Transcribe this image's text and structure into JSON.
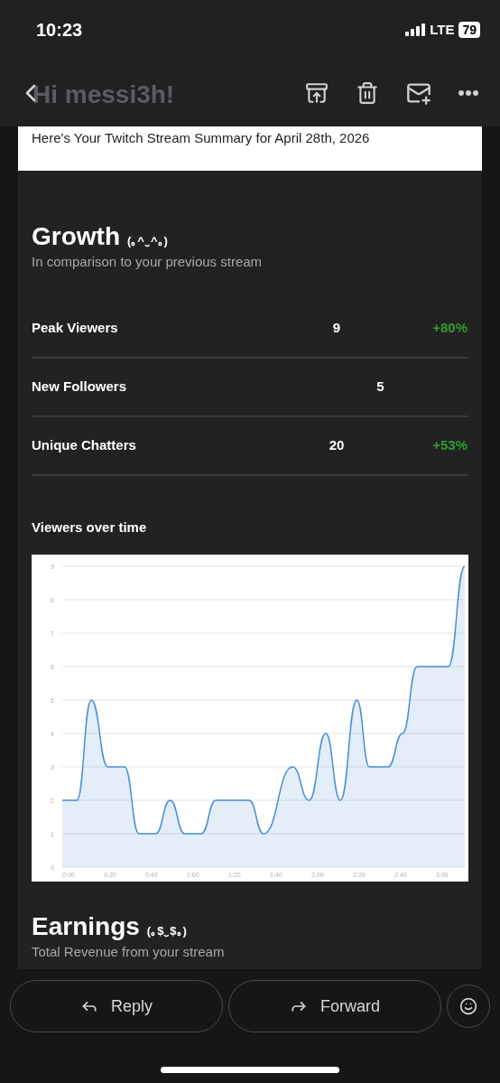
{
  "status_bar": {
    "time": "10:23",
    "network": "LTE",
    "battery": "79"
  },
  "greeting": "Hi messi3h!",
  "banner": "Here's Your Twitch Stream Summary for April 28th, 2026",
  "growth": {
    "title": "Growth",
    "kaomoji": "(｡^‿^｡)",
    "subtitle": "In comparison to your previous stream",
    "stats": [
      {
        "label": "Peak Viewers",
        "value": "9",
        "change": "+80%"
      },
      {
        "label": "New Followers",
        "value": "5"
      },
      {
        "label": "Unique Chatters",
        "value": "20",
        "change": "+53%"
      }
    ]
  },
  "viewers": {
    "title": "Viewers over time",
    "chart_data": {
      "type": "area",
      "x": [
        -3,
        4,
        11,
        19,
        27,
        34,
        42,
        49,
        56,
        64,
        71,
        87,
        94,
        108,
        116,
        124,
        131,
        139,
        145,
        154,
        161,
        168,
        183,
        191
      ],
      "series": [
        {
          "color": "#4a8fd4",
          "values": [
            2,
            2,
            5,
            3,
            3,
            1,
            1,
            2,
            1,
            1,
            2,
            2,
            1,
            3,
            2,
            4,
            2,
            5,
            3,
            3,
            4,
            6,
            6,
            9
          ]
        }
      ],
      "xlim": [
        -3,
        191
      ],
      "grid": true,
      "ylim": [
        0,
        9
      ],
      "yticks": [
        0,
        1,
        2,
        3,
        4,
        5,
        6,
        7,
        8,
        9
      ],
      "xticks": [
        {
          "value": 0,
          "label": "0:00"
        },
        {
          "value": 20,
          "label": "0:20"
        },
        {
          "value": 40,
          "label": "0:40"
        },
        {
          "value": 60,
          "label": "1:00"
        },
        {
          "value": 80,
          "label": "1:20"
        },
        {
          "value": 100,
          "label": "1:40"
        },
        {
          "value": 120,
          "label": "2:00"
        },
        {
          "value": 140,
          "label": "2:20"
        },
        {
          "value": 160,
          "label": "2:40"
        },
        {
          "value": 180,
          "label": "3:00"
        }
      ]
    }
  },
  "earnings": {
    "title": "Earnings",
    "kaomoji": "(｡$‿$｡)",
    "subtitle": "Total Revenue from your stream"
  },
  "actions": [
    {
      "label": "Reply",
      "kind": "reply"
    },
    {
      "label": "Forward",
      "kind": "forward"
    }
  ]
}
